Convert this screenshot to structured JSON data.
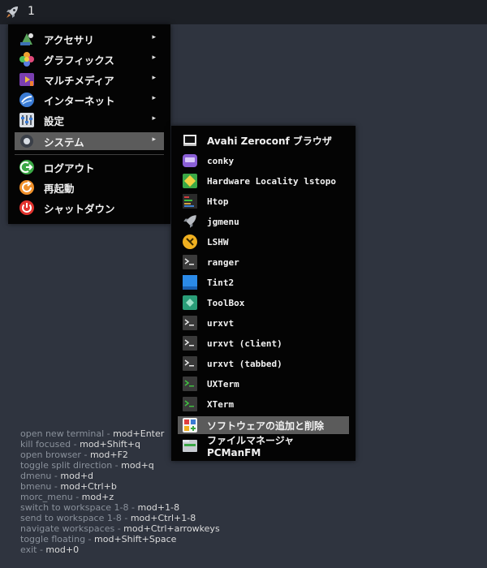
{
  "topbar": {
    "workspace": "1",
    "icon": "rocket-icon"
  },
  "main_menu": {
    "items": [
      {
        "label": "アクセサリ",
        "icon": "accessories-icon",
        "submenu": true
      },
      {
        "label": "グラフィックス",
        "icon": "graphics-icon",
        "submenu": true
      },
      {
        "label": "マルチメディア",
        "icon": "multimedia-icon",
        "submenu": true
      },
      {
        "label": "インターネット",
        "icon": "internet-icon",
        "submenu": true
      },
      {
        "label": "設定",
        "icon": "settings-icon",
        "submenu": true
      },
      {
        "label": "システム",
        "icon": "system-icon",
        "submenu": true,
        "highlighted": true
      },
      {
        "label": "ログアウト",
        "icon": "logout-icon"
      },
      {
        "label": "再起動",
        "icon": "reboot-icon"
      },
      {
        "label": "シャットダウン",
        "icon": "shutdown-icon"
      }
    ],
    "arrow": "▸"
  },
  "system_menu": {
    "items": [
      {
        "label": "Avahi Zeroconf ブラウザ",
        "icon": "network-browser-icon"
      },
      {
        "label": "conky",
        "icon": "conky-icon"
      },
      {
        "label": "Hardware Locality lstopo",
        "icon": "hardware-icon"
      },
      {
        "label": "Htop",
        "icon": "htop-icon"
      },
      {
        "label": "jgmenu",
        "icon": "jgmenu-icon"
      },
      {
        "label": "LSHW",
        "icon": "lshw-icon"
      },
      {
        "label": "ranger",
        "icon": "terminal-icon"
      },
      {
        "label": "Tint2",
        "icon": "tint2-icon"
      },
      {
        "label": "ToolBox",
        "icon": "toolbox-icon"
      },
      {
        "label": "urxvt",
        "icon": "terminal-icon"
      },
      {
        "label": "urxvt (client)",
        "icon": "terminal-icon"
      },
      {
        "label": "urxvt (tabbed)",
        "icon": "terminal-icon"
      },
      {
        "label": "UXTerm",
        "icon": "xterm-icon"
      },
      {
        "label": "XTerm",
        "icon": "xterm-icon"
      },
      {
        "label": "ソフトウェアの追加と削除",
        "icon": "software-icon",
        "highlighted": true
      },
      {
        "label": "ファイルマネージャ PCManFM",
        "icon": "file-manager-icon"
      }
    ]
  },
  "help": {
    "rows": [
      {
        "key": "open new terminal",
        "value": "mod+Enter"
      },
      {
        "key": "kill focused",
        "value": "mod+Shift+q"
      },
      {
        "key": "open browser",
        "value": "mod+F2"
      },
      {
        "key": "toggle split direction",
        "value": "mod+q"
      },
      {
        "key": "dmenu",
        "value": "mod+d"
      },
      {
        "key": "bmenu",
        "value": "mod+Ctrl+b"
      },
      {
        "key": "morc_menu",
        "value": "mod+z"
      },
      {
        "key": "switch to workspace 1-8",
        "value": "mod+1-8"
      },
      {
        "key": "send to workspace 1-8",
        "value": "mod+Ctrl+1-8"
      },
      {
        "key": "navigate workspaces",
        "value": "mod+Ctrl+arrowkeys"
      },
      {
        "key": "toggle floating",
        "value": "mod+Shift+Space"
      },
      {
        "key": "exit",
        "value": "mod+0"
      }
    ],
    "separator": " - "
  },
  "colors": {
    "desktop": "#2f343f",
    "menu_bg": "#040404",
    "highlight": "#5b5b5b",
    "help_key": "#8a919b"
  }
}
